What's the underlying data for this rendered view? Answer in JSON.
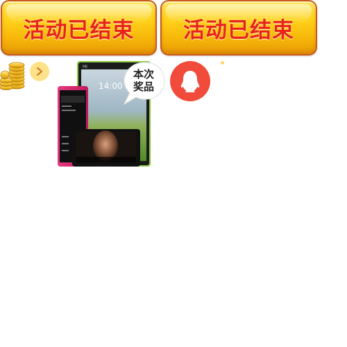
{
  "buttons": {
    "left_label": "活动已结束",
    "right_label": "活动已结束"
  },
  "prize": {
    "bubble_label": "本次\n奖品",
    "tablet_time": "14:00",
    "tablet_brand": "MI"
  },
  "icons": {
    "coins": "gold-coins-icon",
    "arrow": "chevron-right-icon",
    "qq": "qq-penguin-icon"
  },
  "colors": {
    "banner_text": "#e8241a",
    "banner_yellow": "#ffd21a",
    "banner_border": "#c85a1c",
    "qq_red": "#f14b3b",
    "arrow_circle": "#fde28a"
  }
}
